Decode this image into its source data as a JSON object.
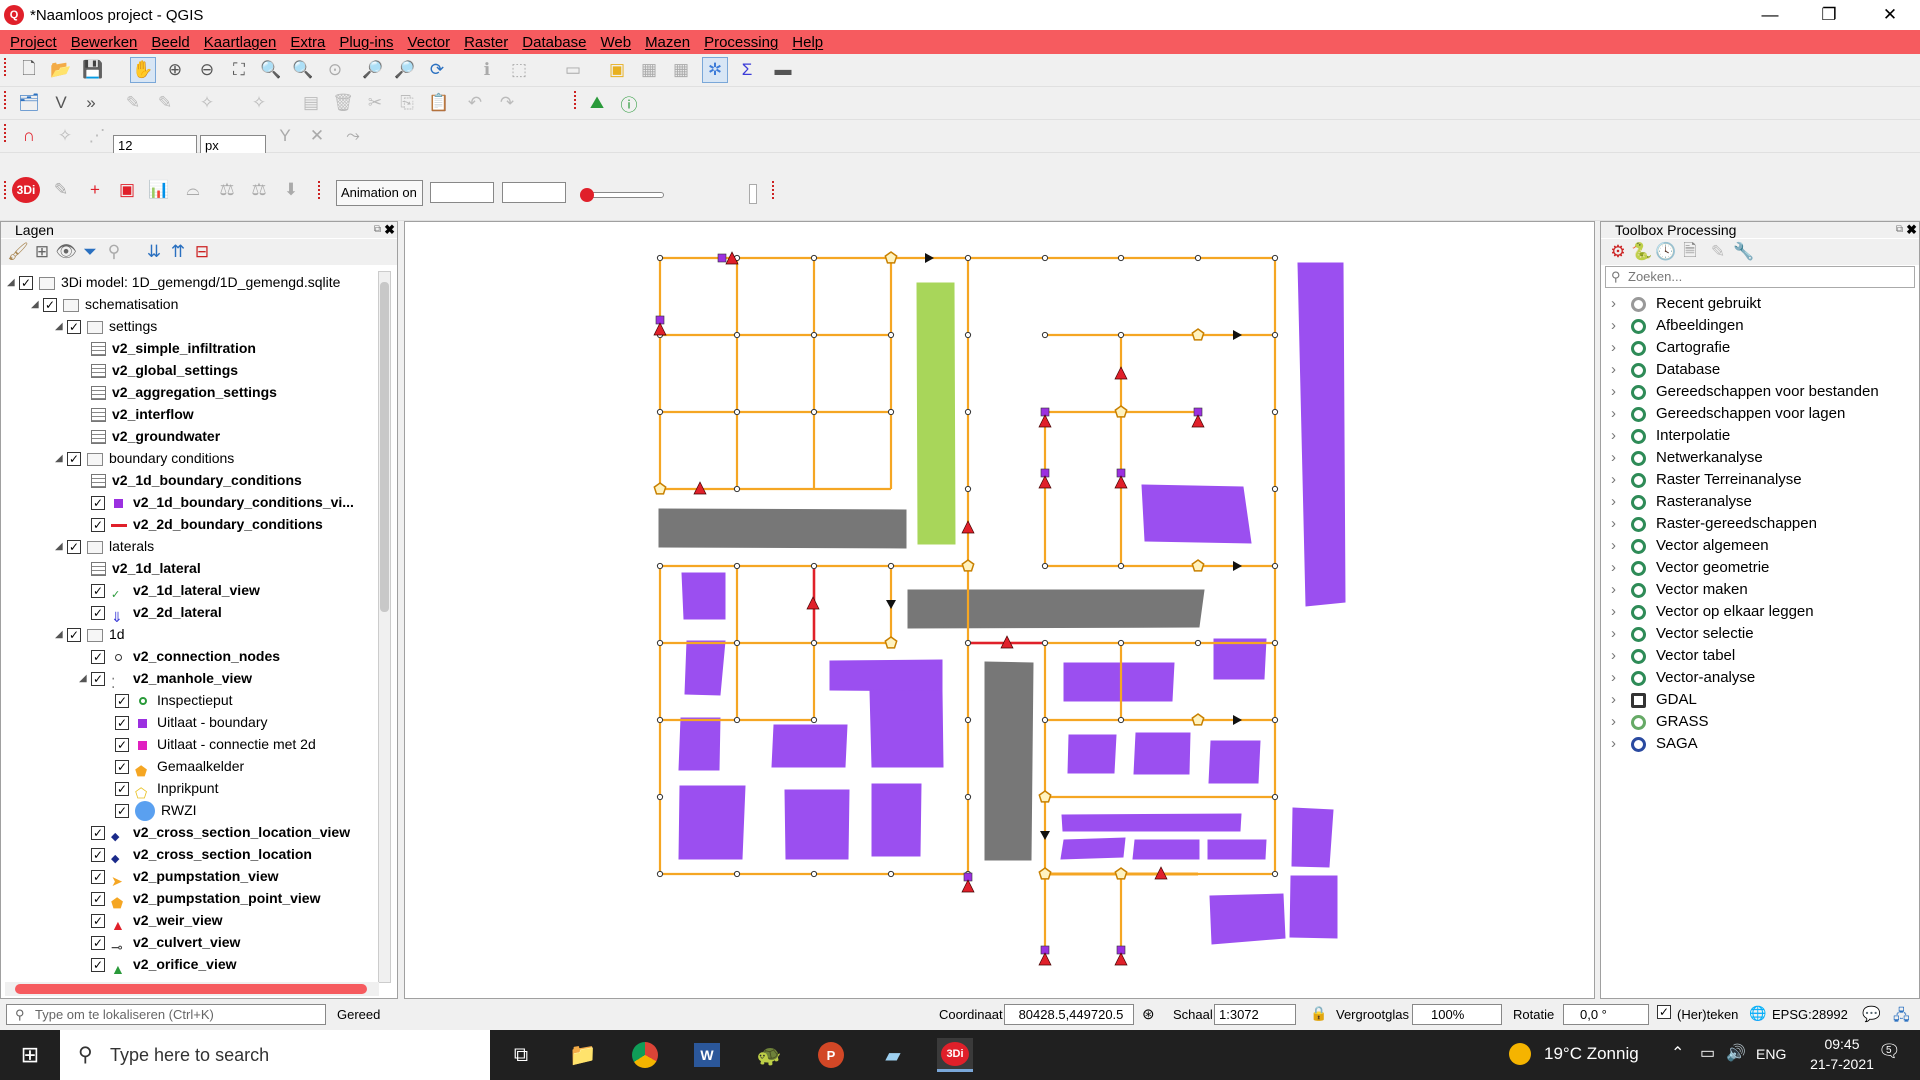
{
  "window": {
    "title": "*Naamloos project - QGIS",
    "logo": "qgis-logo",
    "minimize": "—",
    "restore": "❐",
    "close": "✕"
  },
  "menu": [
    "Project",
    "Bewerken",
    "Beeld",
    "Kaartlagen",
    "Extra",
    "Plug-ins",
    "Vector",
    "Raster",
    "Database",
    "Web",
    "Mazen",
    "Processing",
    "Help"
  ],
  "toolbar": {
    "snap_size": "12",
    "snap_unit": "px",
    "animation_label": "Animation on"
  },
  "layers_panel": {
    "title": "Lagen",
    "rows": [
      {
        "label": "3Di model: 1D_gemengd/1D_gemengd.sqlite",
        "bold": false,
        "indent": 0
      },
      {
        "label": "schematisation",
        "bold": false,
        "indent": 1
      },
      {
        "label": "settings",
        "bold": false,
        "indent": 2
      },
      {
        "label": "v2_simple_infiltration",
        "bold": true,
        "indent": 3
      },
      {
        "label": "v2_global_settings",
        "bold": true,
        "indent": 3
      },
      {
        "label": "v2_aggregation_settings",
        "bold": true,
        "indent": 3
      },
      {
        "label": "v2_interflow",
        "bold": true,
        "indent": 3
      },
      {
        "label": "v2_groundwater",
        "bold": true,
        "indent": 3
      },
      {
        "label": "boundary conditions",
        "bold": false,
        "indent": 2
      },
      {
        "label": "v2_1d_boundary_conditions",
        "bold": true,
        "indent": 3
      },
      {
        "label": "v2_1d_boundary_conditions_vi...",
        "bold": true,
        "indent": 3
      },
      {
        "label": "v2_2d_boundary_conditions",
        "bold": true,
        "indent": 3
      },
      {
        "label": "laterals",
        "bold": false,
        "indent": 2
      },
      {
        "label": "v2_1d_lateral",
        "bold": true,
        "indent": 3
      },
      {
        "label": "v2_1d_lateral_view",
        "bold": true,
        "indent": 3
      },
      {
        "label": "v2_2d_lateral",
        "bold": true,
        "indent": 3
      },
      {
        "label": "1d",
        "bold": false,
        "indent": 2
      },
      {
        "label": "v2_connection_nodes",
        "bold": true,
        "indent": 3
      },
      {
        "label": "v2_manhole_view",
        "bold": true,
        "indent": 3
      },
      {
        "label": "Inspectieput",
        "bold": false,
        "indent": 4
      },
      {
        "label": "Uitlaat - boundary",
        "bold": false,
        "indent": 4
      },
      {
        "label": "Uitlaat - connectie met 2d",
        "bold": false,
        "indent": 4
      },
      {
        "label": "Gemaalkelder",
        "bold": false,
        "indent": 4
      },
      {
        "label": "Inprikpunt",
        "bold": false,
        "indent": 4
      },
      {
        "label": "RWZI",
        "bold": false,
        "indent": 4
      },
      {
        "label": "v2_cross_section_location_view",
        "bold": true,
        "indent": 3
      },
      {
        "label": "v2_cross_section_location",
        "bold": true,
        "indent": 3
      },
      {
        "label": "v2_pumpstation_view",
        "bold": true,
        "indent": 3
      },
      {
        "label": "v2_pumpstation_point_view",
        "bold": true,
        "indent": 3
      },
      {
        "label": "v2_weir_view",
        "bold": true,
        "indent": 3
      },
      {
        "label": "v2_culvert_view",
        "bold": true,
        "indent": 3
      },
      {
        "label": "v2_orifice_view",
        "bold": true,
        "indent": 3
      }
    ]
  },
  "toolbox": {
    "title": "Toolbox Processing",
    "search_placeholder": "Zoeken...",
    "items": [
      "Recent gebruikt",
      "Afbeeldingen",
      "Cartografie",
      "Database",
      "Gereedschappen voor bestanden",
      "Gereedschappen voor lagen",
      "Interpolatie",
      "Netwerkanalyse",
      "Raster Terreinanalyse",
      "Rasteranalyse",
      "Raster-gereedschappen",
      "Vector algemeen",
      "Vector geometrie",
      "Vector maken",
      "Vector op elkaar leggen",
      "Vector selectie",
      "Vector tabel",
      "Vector-analyse",
      "GDAL",
      "GRASS",
      "SAGA"
    ]
  },
  "status": {
    "locator_placeholder": "Type om te lokaliseren (Ctrl+K)",
    "state": "Gereed",
    "coord_label": "Coordinaat",
    "coord": "80428.5,449720.5",
    "scale_label": "Schaal",
    "scale": "1:3072",
    "magnifier_label": "Vergrootglas",
    "magnifier": "100%",
    "rotation_label": "Rotatie",
    "rotation": "0,0 °",
    "render_label": "(Her)teken",
    "crs": "EPSG:28992"
  },
  "taskbar": {
    "search_placeholder": "Type here to search",
    "weather": "19°C Zonnig",
    "lang": "ENG",
    "time": "09:45",
    "date": "21-7-2021",
    "notifications": "5"
  },
  "colors": {
    "menubar": "#f65b5f",
    "pipe": "#f5a623",
    "pipe_red": "#e0202a",
    "building": "#9b4ff0",
    "gray": "#777777",
    "green": "#a8d65a"
  }
}
